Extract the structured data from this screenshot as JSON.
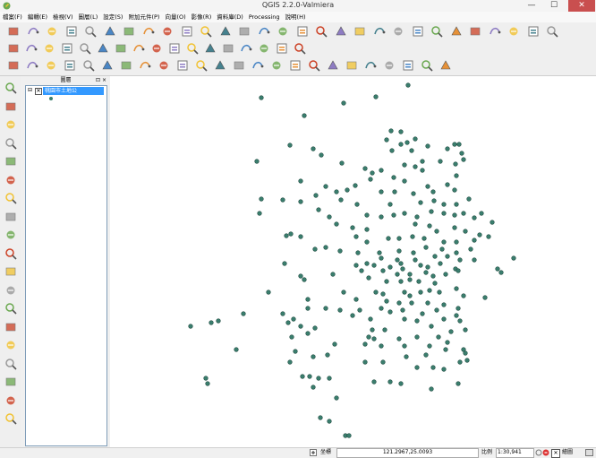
{
  "window": {
    "title": "QGIS 2.2.0-Valmiera",
    "minimize": "—",
    "maximize": "☐",
    "close": "✕"
  },
  "menu": [
    "檔案(F)",
    "編輯(E)",
    "檢視(V)",
    "圖層(L)",
    "設定(S)",
    "附加元件(P)",
    "向量(O)",
    "影像(R)",
    "資料庫(D)",
    "Processing",
    "說明(H)"
  ],
  "legend": {
    "title": "圖層",
    "buttons": "⊡ ×",
    "layer_name": "桃園市土地公",
    "expander": "⊟",
    "checked": "✕"
  },
  "status": {
    "coord_label": "坐標",
    "coord_value": "121.2967,25.0093",
    "scale_label": "比例",
    "scale_value": "1:30,941",
    "render_label": "繪圖"
  },
  "colors": {
    "accent": "#3399ff",
    "point_fill": "#3a7e6e",
    "point_stroke": "#1f4a3f",
    "close": "#c94f4f"
  },
  "icons": {
    "toolbar1": [
      "new-project-icon",
      "open-project-icon",
      "save-project-icon",
      "save-as-icon",
      "new-print-composer-icon",
      "composer-manager-icon",
      "pan-icon",
      "pan-to-selection-icon",
      "zoom-in-icon",
      "zoom-out-icon",
      "zoom-actual-icon",
      "zoom-full-icon",
      "zoom-to-selection-icon",
      "zoom-to-layer-icon",
      "zoom-last-icon",
      "zoom-next-icon",
      "refresh-icon",
      "identify-icon",
      "measure-icon",
      "select-icon",
      "deselect-icon",
      "open-attribute-table-icon",
      "field-calculator-icon",
      "map-tips-icon",
      "new-bookmark-icon",
      "show-bookmarks-icon",
      "text-annotation-icon",
      "help-icon",
      "whats-this-icon"
    ],
    "toolbar2": [
      "current-edits-icon",
      "toggle-editing-icon",
      "save-edits-icon",
      "add-feature-icon",
      "move-feature-icon",
      "node-tool-icon",
      "delete-selected-icon",
      "cut-features-icon",
      "copy-features-icon",
      "paste-features-icon",
      "label-icon",
      "label-pin-icon",
      "label-show-hide-icon",
      "label-move-icon",
      "label-rotate-icon",
      "label-change-icon",
      "label-highlight-icon"
    ],
    "toolbar3": [
      "undo-icon",
      "redo-icon",
      "simplify-icon",
      "add-ring-icon",
      "add-part-icon",
      "fill-ring-icon",
      "delete-ring-icon",
      "delete-part-icon",
      "reshape-icon",
      "offset-curve-icon",
      "split-features-icon",
      "split-parts-icon",
      "merge-features-icon",
      "merge-attributes-icon",
      "rotate-symbols-icon",
      "rotate-feature-icon",
      "vertex-tool-icon",
      "spatial-query-icon",
      "raster-calc-icon",
      "georef-icon",
      "heatmap-icon",
      "topology-icon",
      "interpolation-icon",
      "gps-icon"
    ],
    "left": [
      "add-vector-layer-icon",
      "add-raster-layer-icon",
      "add-postgis-layer-icon",
      "add-spatialite-layer-icon",
      "add-mssql-layer-icon",
      "add-oracle-layer-icon",
      "add-wms-layer-icon",
      "add-wcs-layer-icon",
      "add-wfs-layer-icon",
      "add-delimited-text-icon",
      "add-gpx-icon",
      "new-shapefile-icon",
      "new-spatialite-icon",
      "remove-layer-icon",
      "gps-tools-icon",
      "coordinate-capture-icon",
      "georeferencer-icon",
      "road-graph-icon",
      "shapefile-to-postgis-icon"
    ]
  },
  "map_points": [
    [
      292,
      109
    ],
    [
      384,
      115
    ],
    [
      420,
      108
    ],
    [
      456,
      95
    ],
    [
      340,
      129
    ],
    [
      437,
      146
    ],
    [
      448,
      147
    ],
    [
      432,
      156
    ],
    [
      464,
      155
    ],
    [
      455,
      159
    ],
    [
      448,
      161
    ],
    [
      508,
      161
    ],
    [
      513,
      161
    ],
    [
      324,
      162
    ],
    [
      350,
      166
    ],
    [
      438,
      168
    ],
    [
      460,
      168
    ],
    [
      478,
      163
    ],
    [
      500,
      166
    ],
    [
      516,
      171
    ],
    [
      359,
      173
    ],
    [
      382,
      182
    ],
    [
      287,
      180
    ],
    [
      472,
      180
    ],
    [
      452,
      184
    ],
    [
      464,
      186
    ],
    [
      492,
      180
    ],
    [
      518,
      178
    ],
    [
      509,
      183
    ],
    [
      408,
      188
    ],
    [
      426,
      190
    ],
    [
      416,
      193
    ],
    [
      472,
      190
    ],
    [
      440,
      198
    ],
    [
      452,
      202
    ],
    [
      414,
      200
    ],
    [
      336,
      202
    ],
    [
      364,
      208
    ],
    [
      376,
      214
    ],
    [
      397,
      207
    ],
    [
      388,
      212
    ],
    [
      353,
      218
    ],
    [
      426,
      214
    ],
    [
      441,
      214
    ],
    [
      462,
      216
    ],
    [
      484,
      214
    ],
    [
      478,
      208
    ],
    [
      500,
      206
    ],
    [
      510,
      196
    ],
    [
      508,
      212
    ],
    [
      292,
      222
    ],
    [
      316,
      223
    ],
    [
      336,
      225
    ],
    [
      381,
      223
    ],
    [
      399,
      228
    ],
    [
      436,
      228
    ],
    [
      470,
      226
    ],
    [
      485,
      224
    ],
    [
      496,
      228
    ],
    [
      510,
      228
    ],
    [
      524,
      222
    ],
    [
      538,
      238
    ],
    [
      550,
      248
    ],
    [
      356,
      234
    ],
    [
      368,
      242
    ],
    [
      410,
      240
    ],
    [
      426,
      242
    ],
    [
      440,
      240
    ],
    [
      452,
      238
    ],
    [
      466,
      242
    ],
    [
      482,
      236
    ],
    [
      496,
      238
    ],
    [
      508,
      240
    ],
    [
      518,
      238
    ],
    [
      530,
      243
    ],
    [
      290,
      238
    ],
    [
      376,
      250
    ],
    [
      394,
      254
    ],
    [
      410,
      256
    ],
    [
      464,
      250
    ],
    [
      480,
      252
    ],
    [
      488,
      258
    ],
    [
      508,
      254
    ],
    [
      520,
      258
    ],
    [
      536,
      262
    ],
    [
      546,
      264
    ],
    [
      320,
      263
    ],
    [
      325,
      261
    ],
    [
      336,
      264
    ],
    [
      398,
      264
    ],
    [
      410,
      270
    ],
    [
      434,
      266
    ],
    [
      446,
      266
    ],
    [
      461,
      264
    ],
    [
      474,
      266
    ],
    [
      496,
      270
    ],
    [
      510,
      270
    ],
    [
      530,
      268
    ],
    [
      352,
      278
    ],
    [
      364,
      276
    ],
    [
      380,
      280
    ],
    [
      400,
      282
    ],
    [
      424,
      282
    ],
    [
      446,
      280
    ],
    [
      462,
      282
    ],
    [
      476,
      276
    ],
    [
      494,
      278
    ],
    [
      510,
      282
    ],
    [
      526,
      278
    ],
    [
      574,
      288
    ],
    [
      426,
      288
    ],
    [
      444,
      290
    ],
    [
      448,
      294
    ],
    [
      464,
      290
    ],
    [
      486,
      286
    ],
    [
      500,
      286
    ],
    [
      514,
      290
    ],
    [
      530,
      290
    ],
    [
      318,
      294
    ],
    [
      398,
      296
    ],
    [
      410,
      294
    ],
    [
      418,
      296
    ],
    [
      436,
      298
    ],
    [
      450,
      300
    ],
    [
      470,
      296
    ],
    [
      478,
      298
    ],
    [
      492,
      294
    ],
    [
      509,
      300
    ],
    [
      556,
      300
    ],
    [
      560,
      304
    ],
    [
      372,
      306
    ],
    [
      404,
      302
    ],
    [
      428,
      302
    ],
    [
      444,
      306
    ],
    [
      458,
      306
    ],
    [
      476,
      304
    ],
    [
      484,
      308
    ],
    [
      498,
      306
    ],
    [
      512,
      302
    ],
    [
      336,
      308
    ],
    [
      340,
      312
    ],
    [
      412,
      310
    ],
    [
      432,
      314
    ],
    [
      448,
      314
    ],
    [
      458,
      312
    ],
    [
      468,
      314
    ],
    [
      486,
      316
    ],
    [
      300,
      326
    ],
    [
      384,
      326
    ],
    [
      420,
      326
    ],
    [
      428,
      328
    ],
    [
      452,
      326
    ],
    [
      458,
      330
    ],
    [
      470,
      326
    ],
    [
      480,
      324
    ],
    [
      491,
      326
    ],
    [
      510,
      322
    ],
    [
      518,
      330
    ],
    [
      542,
      332
    ],
    [
      344,
      334
    ],
    [
      398,
      334
    ],
    [
      432,
      336
    ],
    [
      446,
      338
    ],
    [
      460,
      338
    ],
    [
      478,
      338
    ],
    [
      496,
      340
    ],
    [
      512,
      344
    ],
    [
      344,
      344
    ],
    [
      364,
      344
    ],
    [
      380,
      346
    ],
    [
      402,
      346
    ],
    [
      426,
      344
    ],
    [
      436,
      348
    ],
    [
      450,
      346
    ],
    [
      472,
      350
    ],
    [
      488,
      346
    ],
    [
      510,
      352
    ],
    [
      272,
      350
    ],
    [
      316,
      350
    ],
    [
      328,
      356
    ],
    [
      394,
      352
    ],
    [
      414,
      356
    ],
    [
      452,
      356
    ],
    [
      466,
      358
    ],
    [
      496,
      356
    ],
    [
      514,
      358
    ],
    [
      213,
      364
    ],
    [
      236,
      360
    ],
    [
      244,
      358
    ],
    [
      322,
      360
    ],
    [
      336,
      364
    ],
    [
      352,
      366
    ],
    [
      416,
      368
    ],
    [
      430,
      368
    ],
    [
      482,
      364
    ],
    [
      504,
      370
    ],
    [
      520,
      368
    ],
    [
      344,
      372
    ],
    [
      326,
      376
    ],
    [
      412,
      376
    ],
    [
      418,
      378
    ],
    [
      446,
      378
    ],
    [
      466,
      376
    ],
    [
      490,
      376
    ],
    [
      500,
      382
    ],
    [
      374,
      384
    ],
    [
      408,
      384
    ],
    [
      426,
      386
    ],
    [
      452,
      386
    ],
    [
      480,
      386
    ],
    [
      498,
      390
    ],
    [
      518,
      390
    ],
    [
      520,
      394
    ],
    [
      264,
      390
    ],
    [
      330,
      392
    ],
    [
      366,
      396
    ],
    [
      350,
      398
    ],
    [
      476,
      396
    ],
    [
      454,
      398
    ],
    [
      324,
      404
    ],
    [
      408,
      404
    ],
    [
      428,
      404
    ],
    [
      514,
      404
    ],
    [
      522,
      402
    ],
    [
      466,
      410
    ],
    [
      484,
      410
    ],
    [
      496,
      412
    ],
    [
      338,
      420
    ],
    [
      346,
      420
    ],
    [
      356,
      422
    ],
    [
      368,
      422
    ],
    [
      230,
      422
    ],
    [
      232,
      428
    ],
    [
      418,
      426
    ],
    [
      436,
      426
    ],
    [
      448,
      428
    ],
    [
      512,
      428
    ],
    [
      350,
      432
    ],
    [
      482,
      434
    ],
    [
      376,
      444
    ],
    [
      358,
      466
    ],
    [
      368,
      470
    ],
    [
      386,
      486
    ],
    [
      390,
      486
    ]
  ]
}
